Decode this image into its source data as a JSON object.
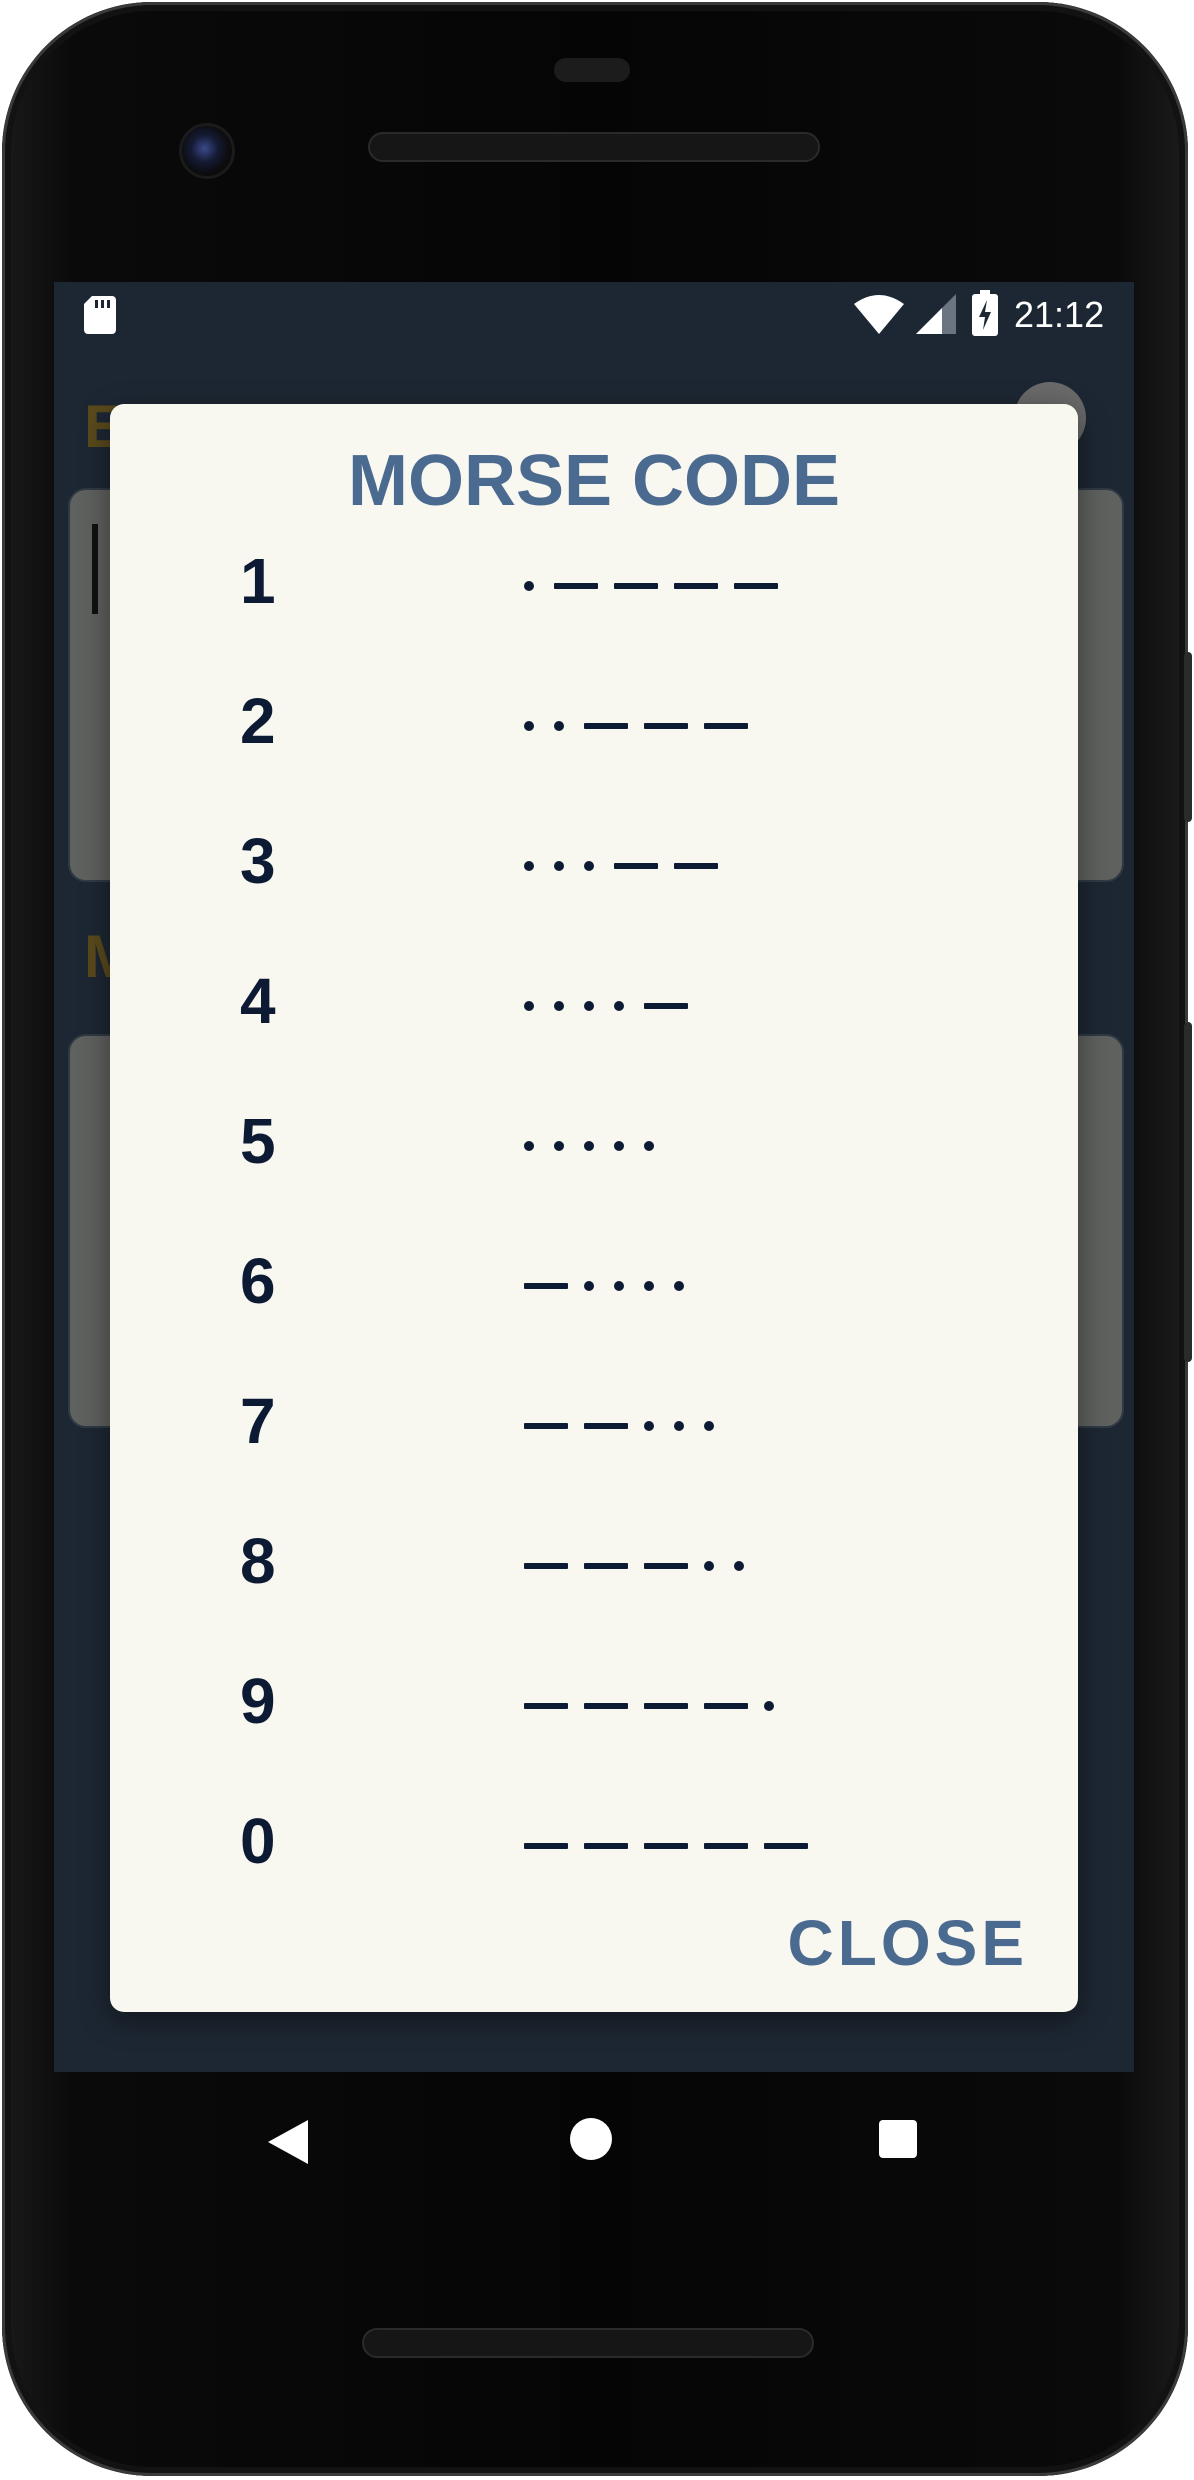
{
  "status_bar": {
    "time": "21:12",
    "icons": [
      "sd-card-icon",
      "wifi-icon",
      "signal-icon",
      "battery-charging-icon"
    ]
  },
  "background_app": {
    "title_partial": "ENGLISH",
    "second_title_partial": "M"
  },
  "dialog": {
    "title": "MORSE CODE",
    "rows": [
      {
        "digit": "1",
        "code": ".----"
      },
      {
        "digit": "2",
        "code": "..---"
      },
      {
        "digit": "3",
        "code": "...--"
      },
      {
        "digit": "4",
        "code": "....-"
      },
      {
        "digit": "5",
        "code": "....."
      },
      {
        "digit": "6",
        "code": "-...."
      },
      {
        "digit": "7",
        "code": "--..."
      },
      {
        "digit": "8",
        "code": "---.."
      },
      {
        "digit": "9",
        "code": "----."
      },
      {
        "digit": "0",
        "code": "-----"
      }
    ],
    "close_label": "CLOSE"
  },
  "nav_bar": {
    "icons": [
      "back-icon",
      "home-icon",
      "recents-icon"
    ]
  },
  "colors": {
    "accent": "#4b6a8f",
    "text_dark": "#0c1b33",
    "dialog_bg": "#f8f7f0",
    "screen_bg": "#1d2733"
  }
}
